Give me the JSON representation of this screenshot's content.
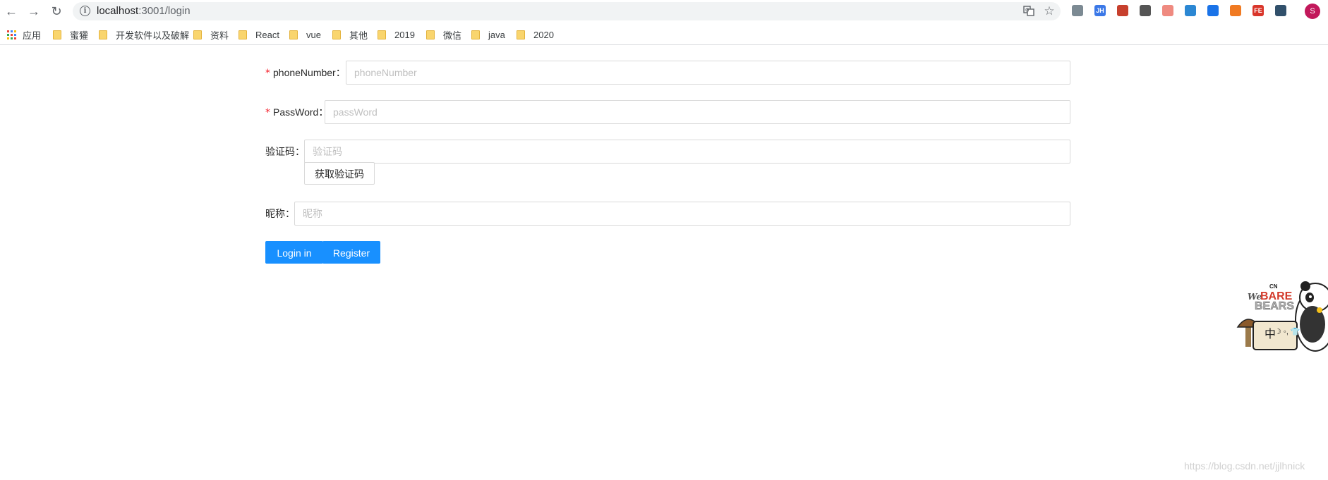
{
  "browser": {
    "url_host": "localhost",
    "url_rest": ":3001/login",
    "avatar_letter": "S",
    "extensions": [
      {
        "icon": "vue-devtools-icon",
        "label": "",
        "color": "#7c8a93"
      },
      {
        "icon": "jh-extension-icon",
        "label": "JH",
        "color": "#3b78e7"
      },
      {
        "icon": "red-extension-icon",
        "label": "",
        "color": "#c7402d"
      },
      {
        "icon": "qr-code-icon",
        "label": "",
        "color": "#555555"
      },
      {
        "icon": "store-icon",
        "label": "",
        "color": "#ef8a80"
      },
      {
        "icon": "pinwheel-icon",
        "label": "",
        "color": "#2b87d3"
      },
      {
        "icon": "save-extension-icon",
        "label": "",
        "color": "#1a73e8"
      },
      {
        "icon": "orange-extension-icon",
        "label": "",
        "color": "#f07a22"
      },
      {
        "icon": "fe-helper-icon",
        "label": "FE",
        "color": "#d9362b"
      },
      {
        "icon": "bird-extension-icon",
        "label": "",
        "color": "#31506b"
      }
    ]
  },
  "bookmarks": {
    "apps_label": "应用",
    "folders": [
      "蜜獾",
      "开发软件以及破解",
      "资料",
      "React",
      "vue",
      "其他",
      "2019",
      "微信",
      "java",
      "2020"
    ]
  },
  "form": {
    "phone": {
      "label": "phoneNumber",
      "placeholder": "phoneNumber",
      "value": ""
    },
    "password": {
      "label": "PassWord",
      "placeholder": "passWord",
      "value": ""
    },
    "code": {
      "label": "验证码",
      "placeholder": "验证码",
      "value": "",
      "button": "获取验证码"
    },
    "nickname": {
      "label": "昵称",
      "placeholder": "昵称",
      "value": ""
    },
    "colon": "：",
    "required_mark": "*",
    "login_button": "Login in",
    "register_button": "Register"
  },
  "mascot": {
    "brand": "CN",
    "line1": "We",
    "line2": "BARE",
    "line3": "BEARS",
    "badge_char": "中",
    "icons": "☽ ◦, 👕"
  },
  "watermark": "https://blog.csdn.net/jjlhnick",
  "colors": {
    "primary": "#1890ff",
    "required": "#f5222d",
    "border": "#d9d9d9"
  }
}
